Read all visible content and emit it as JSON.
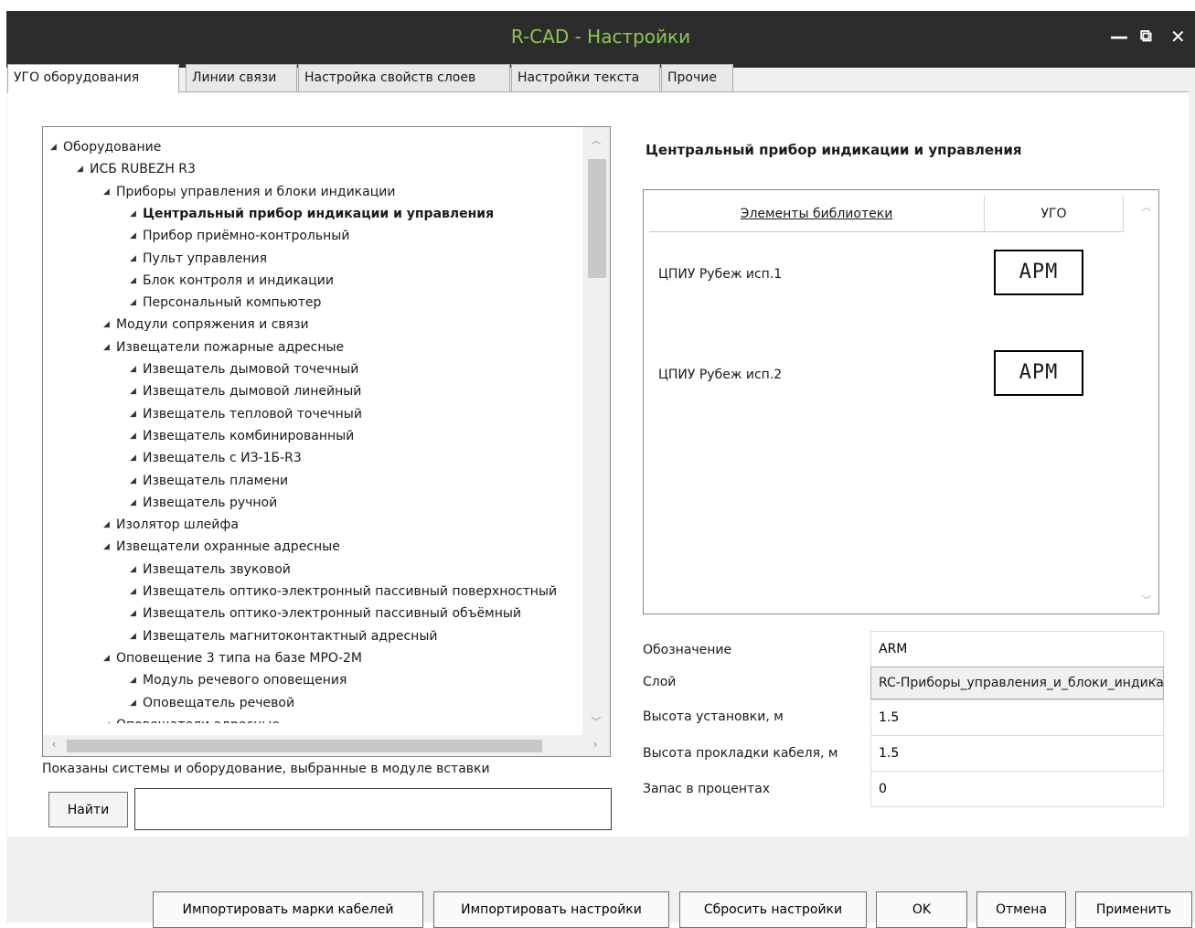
{
  "window": {
    "title": "R-CAD - Настройки",
    "minimize": "—",
    "restore": "⧉",
    "close": "✕"
  },
  "tabs": [
    {
      "label": "УГО оборудования",
      "active": true
    },
    {
      "label": "Линии связи"
    },
    {
      "label": "Настройка свойств слоев"
    },
    {
      "label": "Настройки текста"
    },
    {
      "label": "Прочие"
    }
  ],
  "tree": {
    "items": [
      {
        "label": "Оборудование",
        "level": 0
      },
      {
        "label": "ИСБ RUBEZH R3",
        "level": 1
      },
      {
        "label": "Приборы управления и блоки индикации",
        "level": 2
      },
      {
        "label": "Центральный прибор индикации и управления",
        "level": 3,
        "selected": true
      },
      {
        "label": "Прибор приёмно-контрольный",
        "level": 3
      },
      {
        "label": "Пульт управления",
        "level": 3
      },
      {
        "label": "Блок контроля и индикации",
        "level": 3
      },
      {
        "label": "Персональный компьютер",
        "level": 3
      },
      {
        "label": "Модули сопряжения и связи",
        "level": 2
      },
      {
        "label": "Извещатели пожарные адресные",
        "level": 2
      },
      {
        "label": "Извещатель дымовой точечный",
        "level": 3
      },
      {
        "label": "Извещатель дымовой линейный",
        "level": 3
      },
      {
        "label": "Извещатель тепловой точечный",
        "level": 3
      },
      {
        "label": "Извещатель комбинированный",
        "level": 3
      },
      {
        "label": "Извещатель с ИЗ-1Б-R3",
        "level": 3
      },
      {
        "label": "Извещатель пламени",
        "level": 3
      },
      {
        "label": "Извещатель ручной",
        "level": 3
      },
      {
        "label": "Изолятор шлейфа",
        "level": 2
      },
      {
        "label": "Извещатели охранные адресные",
        "level": 2
      },
      {
        "label": "Извещатель звуковой",
        "level": 3
      },
      {
        "label": "Извещатель оптико-электронный пассивный поверхностный",
        "level": 3
      },
      {
        "label": "Извещатель оптико-электронный пассивный объёмный",
        "level": 3
      },
      {
        "label": "Извещатель магнитоконтактный адресный",
        "level": 3
      },
      {
        "label": "Оповещение 3 типа на базе МРО-2М",
        "level": 2
      },
      {
        "label": "Модуль речевого оповещения",
        "level": 3
      },
      {
        "label": "Оповещатель речевой",
        "level": 3
      },
      {
        "label": "Оповещатели адресные",
        "level": 2
      }
    ]
  },
  "hint": "Показаны системы и оборудование, выбранные в модуле вставки",
  "search": {
    "button": "Найти",
    "value": ""
  },
  "details": {
    "title": "Центральный прибор индикации и управления",
    "columns": [
      "Элементы библиотеки",
      "УГО"
    ],
    "rows": [
      {
        "name": "ЦПИУ Рубеж исп.1",
        "ugo": "APM"
      },
      {
        "name": "ЦПИУ Рубеж исп.2",
        "ugo": "APM"
      }
    ]
  },
  "properties": [
    {
      "label": "Обозначение",
      "value": "ARM"
    },
    {
      "label": "Слой",
      "value": "RC-Приборы_управления_и_блоки_индикации"
    },
    {
      "label": "Высота установки, м",
      "value": "1.5"
    },
    {
      "label": "Высота прокладки кабеля, м",
      "value": "1.5"
    },
    {
      "label": "Запас в процентах",
      "value": "0"
    }
  ],
  "buttons": {
    "import_cables": "Импортировать марки кабелей",
    "import_settings": "Импортировать настройки",
    "reset": "Сбросить настройки",
    "ok": "OK",
    "cancel": "Отмена",
    "apply": "Применить"
  }
}
